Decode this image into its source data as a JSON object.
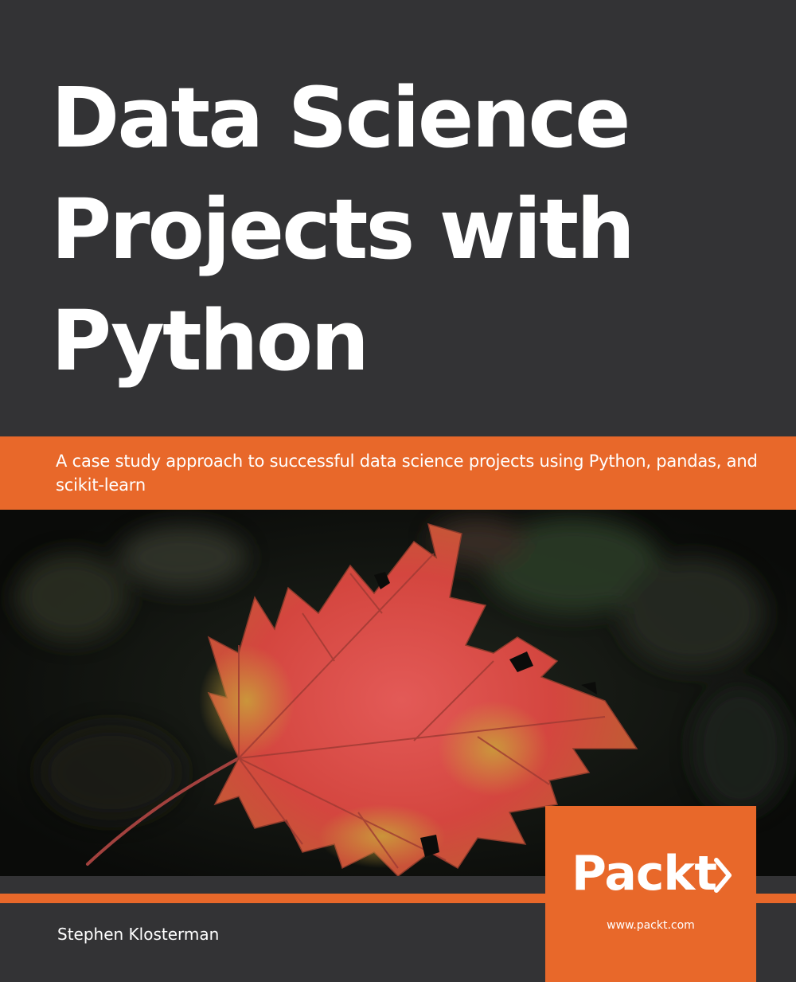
{
  "cover": {
    "title_lines": [
      "Data Science",
      "Projects with",
      "Python"
    ],
    "subtitle": "A case study approach to successful data science projects using Python, pandas, and scikit-learn",
    "author": "Stephen Klosterman",
    "publisher": {
      "logo_text": "Packt",
      "logo_mark": "chevron-right-icon",
      "url": "www.packt.com"
    },
    "image": {
      "subject": "red-maple-leaf-photo"
    }
  },
  "colors": {
    "background": "#333335",
    "accent": "#e8682a",
    "text": "#ffffff",
    "leaf_red": "#d94a45",
    "leaf_yellow": "#c9a33a",
    "photo_dark": "#0b0c0a"
  }
}
